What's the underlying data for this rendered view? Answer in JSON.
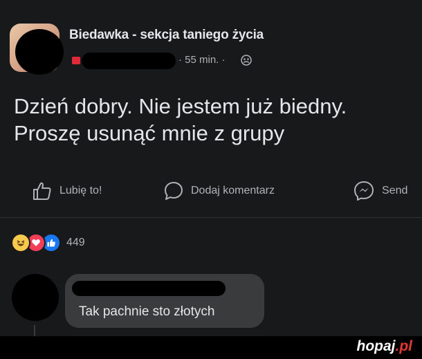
{
  "post": {
    "group_name": "Biedawka - sekcja taniego życia",
    "time": "· 55 min. ·",
    "audience_icon": "group-audience-icon",
    "text_line1": "Dzień dobry. Nie jestem już biedny.",
    "text_line2": "Proszę usunąć mnie z grupy"
  },
  "actions": {
    "like_label": "Lubię to!",
    "comment_label": "Dodaj komentarz",
    "send_label": "Send"
  },
  "reactions": {
    "types": [
      "haha",
      "love",
      "like"
    ],
    "count": "449"
  },
  "comment": {
    "text": "Tak pachnie sto złotych"
  },
  "watermark": {
    "main": "hopaj",
    "accent": ".pl"
  },
  "colors": {
    "background": "#18191a",
    "text_primary": "#e4e6eb",
    "text_secondary": "#b0b3b8",
    "bubble": "#3a3b3c",
    "like_blue": "#1877f2",
    "love_red": "#f33e58",
    "haha_yellow": "#f7c94c"
  }
}
